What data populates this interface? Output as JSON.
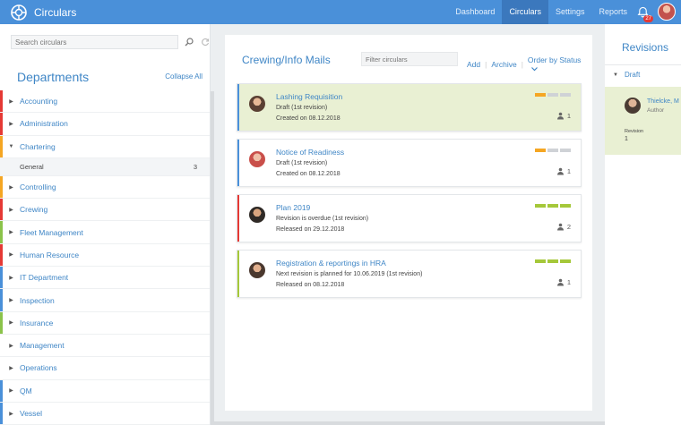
{
  "app": {
    "title": "Circulars"
  },
  "nav": [
    {
      "label": "Dashboard",
      "active": false
    },
    {
      "label": "Circulars",
      "active": true
    },
    {
      "label": "Settings",
      "active": false
    },
    {
      "label": "Reports",
      "active": false
    }
  ],
  "notifications": {
    "count": "27"
  },
  "sidebar": {
    "search_placeholder": "Search circulars",
    "title": "Departments",
    "collapse_all": "Collapse All",
    "items": [
      {
        "label": "Accounting",
        "color": "#e53935",
        "expanded": false
      },
      {
        "label": "Administration",
        "color": "#e53935",
        "expanded": false
      },
      {
        "label": "Chartering",
        "color": "#f5a623",
        "expanded": true,
        "sub": {
          "label": "General",
          "count": "3"
        }
      },
      {
        "label": "Controlling",
        "color": "#f5a623",
        "expanded": false
      },
      {
        "label": "Crewing",
        "color": "#e53935",
        "expanded": false
      },
      {
        "label": "Fleet Management",
        "color": "#8bc34a",
        "expanded": false
      },
      {
        "label": "Human Resource",
        "color": "#e53935",
        "expanded": false
      },
      {
        "label": "IT Department",
        "color": "#4a90d9",
        "expanded": false
      },
      {
        "label": "Inspection",
        "color": "#4a90d9",
        "expanded": false
      },
      {
        "label": "Insurance",
        "color": "#8bc34a",
        "expanded": false
      },
      {
        "label": "Management",
        "color": "#ffffff",
        "expanded": false
      },
      {
        "label": "Operations",
        "color": "#ffffff",
        "expanded": false
      },
      {
        "label": "QM",
        "color": "#4a90d9",
        "expanded": false
      },
      {
        "label": "Vessel",
        "color": "#4a90d9",
        "expanded": false
      }
    ]
  },
  "middle": {
    "title": "Crewing/Info Mails",
    "filter_placeholder": "Filter circulars",
    "add": "Add",
    "archive": "Archive",
    "order": "Order by Status"
  },
  "cards": [
    {
      "title": "Lashing Requisition",
      "status": "Draft (1st revision)",
      "date": "Created on 08.12.2018",
      "count": "1",
      "bar": "#4a90d9",
      "bg": "#e9f0d3",
      "ind": [
        "#f5a623",
        "#cfd2d6",
        "#cfd2d6"
      ]
    },
    {
      "title": "Notice of Readiness",
      "status": "Draft (1st revision)",
      "date": "Created on 08.12.2018",
      "count": "1",
      "bar": "#4a90d9",
      "bg": "#ffffff",
      "ind": [
        "#f5a623",
        "#cfd2d6",
        "#cfd2d6"
      ]
    },
    {
      "title": "Plan 2019",
      "status": "Revision is overdue (1st revision)",
      "date": "Released on 29.12.2018",
      "count": "2",
      "bar": "#e53935",
      "bg": "#ffffff",
      "ind": [
        "#a5c83a",
        "#a5c83a",
        "#a5c83a"
      ]
    },
    {
      "title": "Registration & reportings in HRA",
      "status": "Next revision is planned for 10.06.2019 (1st revision)",
      "date": "Released on 08.12.2018",
      "count": "1",
      "bar": "#a5c83a",
      "bg": "#ffffff",
      "ind": [
        "#a5c83a",
        "#a5c83a",
        "#a5c83a"
      ]
    }
  ],
  "revisions": {
    "title": "Revisions",
    "draft": "Draft",
    "author_name": "Thielcke, M",
    "author_role": "Author",
    "revision_label": "Revision",
    "revision_num": "1"
  }
}
